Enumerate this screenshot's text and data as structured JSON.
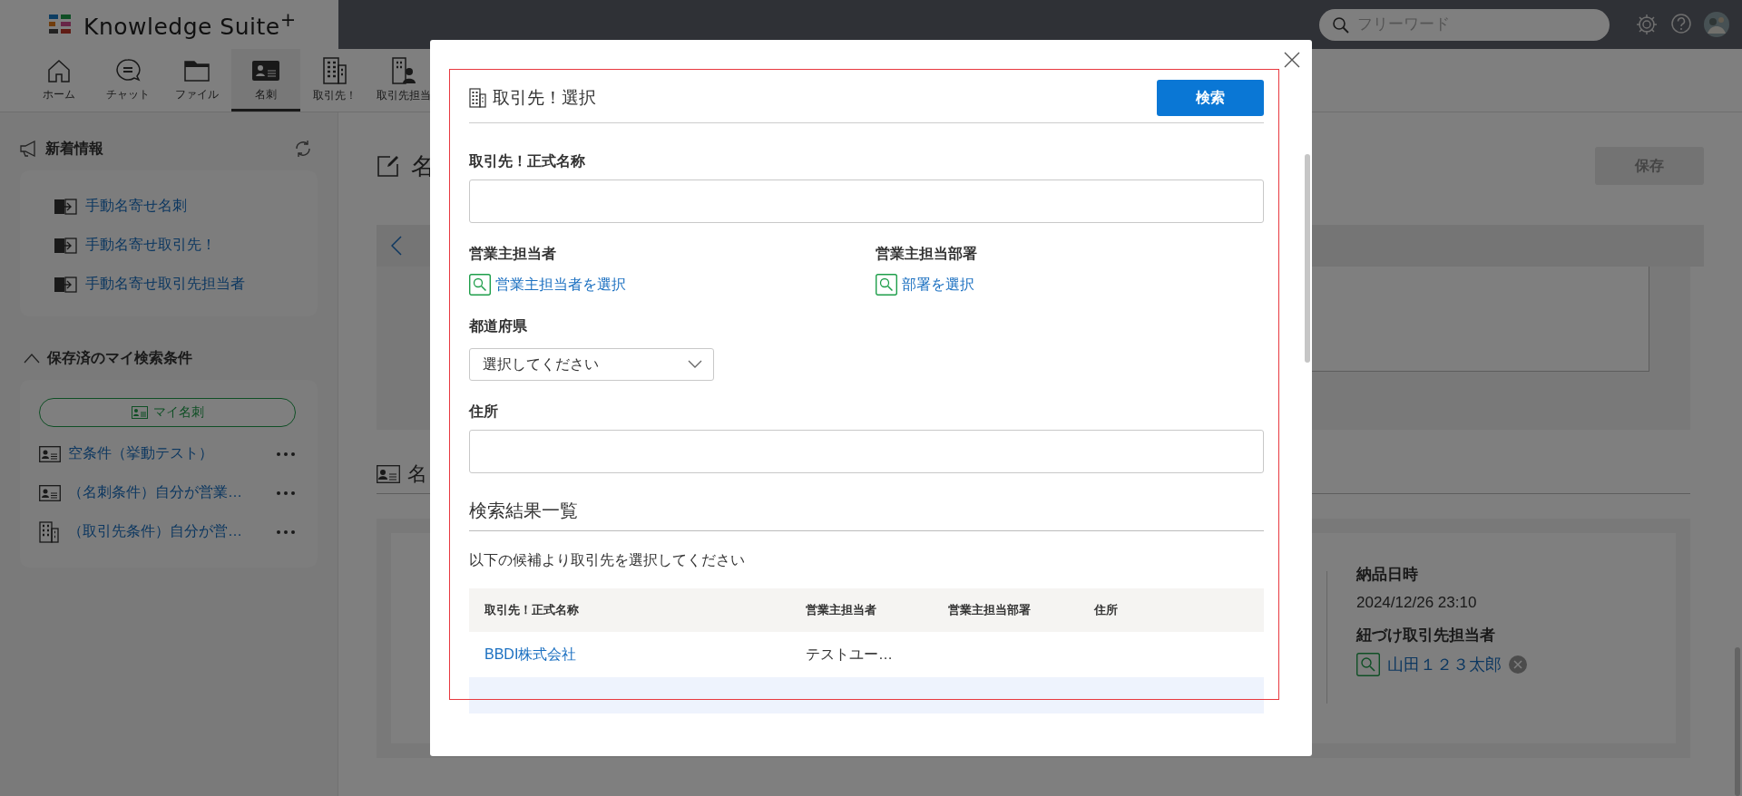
{
  "header": {
    "logo": "Knowledge Suite$^{+}$",
    "search": {
      "placeholder": "フリーワード"
    }
  },
  "nav": [
    {
      "label": "ホーム",
      "kind": "home",
      "selected": false
    },
    {
      "label": "チャット",
      "kind": "chat",
      "selected": false
    },
    {
      "label": "ファイル",
      "kind": "folder",
      "selected": false
    },
    {
      "label": "名刺",
      "kind": "card",
      "selected": true
    },
    {
      "label": "取引先！",
      "kind": "building",
      "selected": false
    },
    {
      "label": "取引先担当",
      "kind": "contact",
      "selected": false
    }
  ],
  "sidebar": {
    "news": {
      "title": "新着情報",
      "items": [
        "手動名寄せ名刺",
        "手動名寄せ取引先！",
        "手動名寄せ取引先担当者"
      ]
    },
    "saved": {
      "title": "保存済のマイ検索条件",
      "expanded": true,
      "my_button": "マイ名刺",
      "items": [
        {
          "label": "空条件（挙動テスト）",
          "kind": "card"
        },
        {
          "label": "（名刺条件）自分が営業…",
          "kind": "card"
        },
        {
          "label": "（取引先条件）自分が営…",
          "kind": "building"
        }
      ]
    }
  },
  "main": {
    "title": "名",
    "save_button": {
      "label": "保存",
      "disabled": true
    },
    "section_title": "名",
    "details": [
      {
        "label": "納品日時",
        "value": "2024/12/26 23:10"
      },
      {
        "label": "紐づけ取引先担当者",
        "link": "山田１２３太郎"
      }
    ]
  },
  "modal": {
    "title": "取引先！選択",
    "search_button": "検索",
    "fields": [
      {
        "kind": "text",
        "label": "取引先！正式名称"
      },
      {
        "kind": "picker",
        "label": "営業主担当者",
        "link": "営業主担当者を選択"
      },
      {
        "kind": "picker",
        "label": "営業主担当部署",
        "link": "部署を選択"
      },
      {
        "kind": "select",
        "label": "都道府県",
        "value": "選択してください"
      },
      {
        "kind": "text",
        "label": "住所"
      }
    ],
    "results": {
      "title": "検索結果一覧",
      "instruction": "以下の候補より取引先を選択してください",
      "columns": [
        "取引先！正式名称",
        "営業主担当者",
        "営業主担当部署",
        "住所"
      ],
      "rows": [
        {
          "cells": [
            "BBDI株式会社",
            "テストユー…"
          ]
        }
      ]
    }
  }
}
